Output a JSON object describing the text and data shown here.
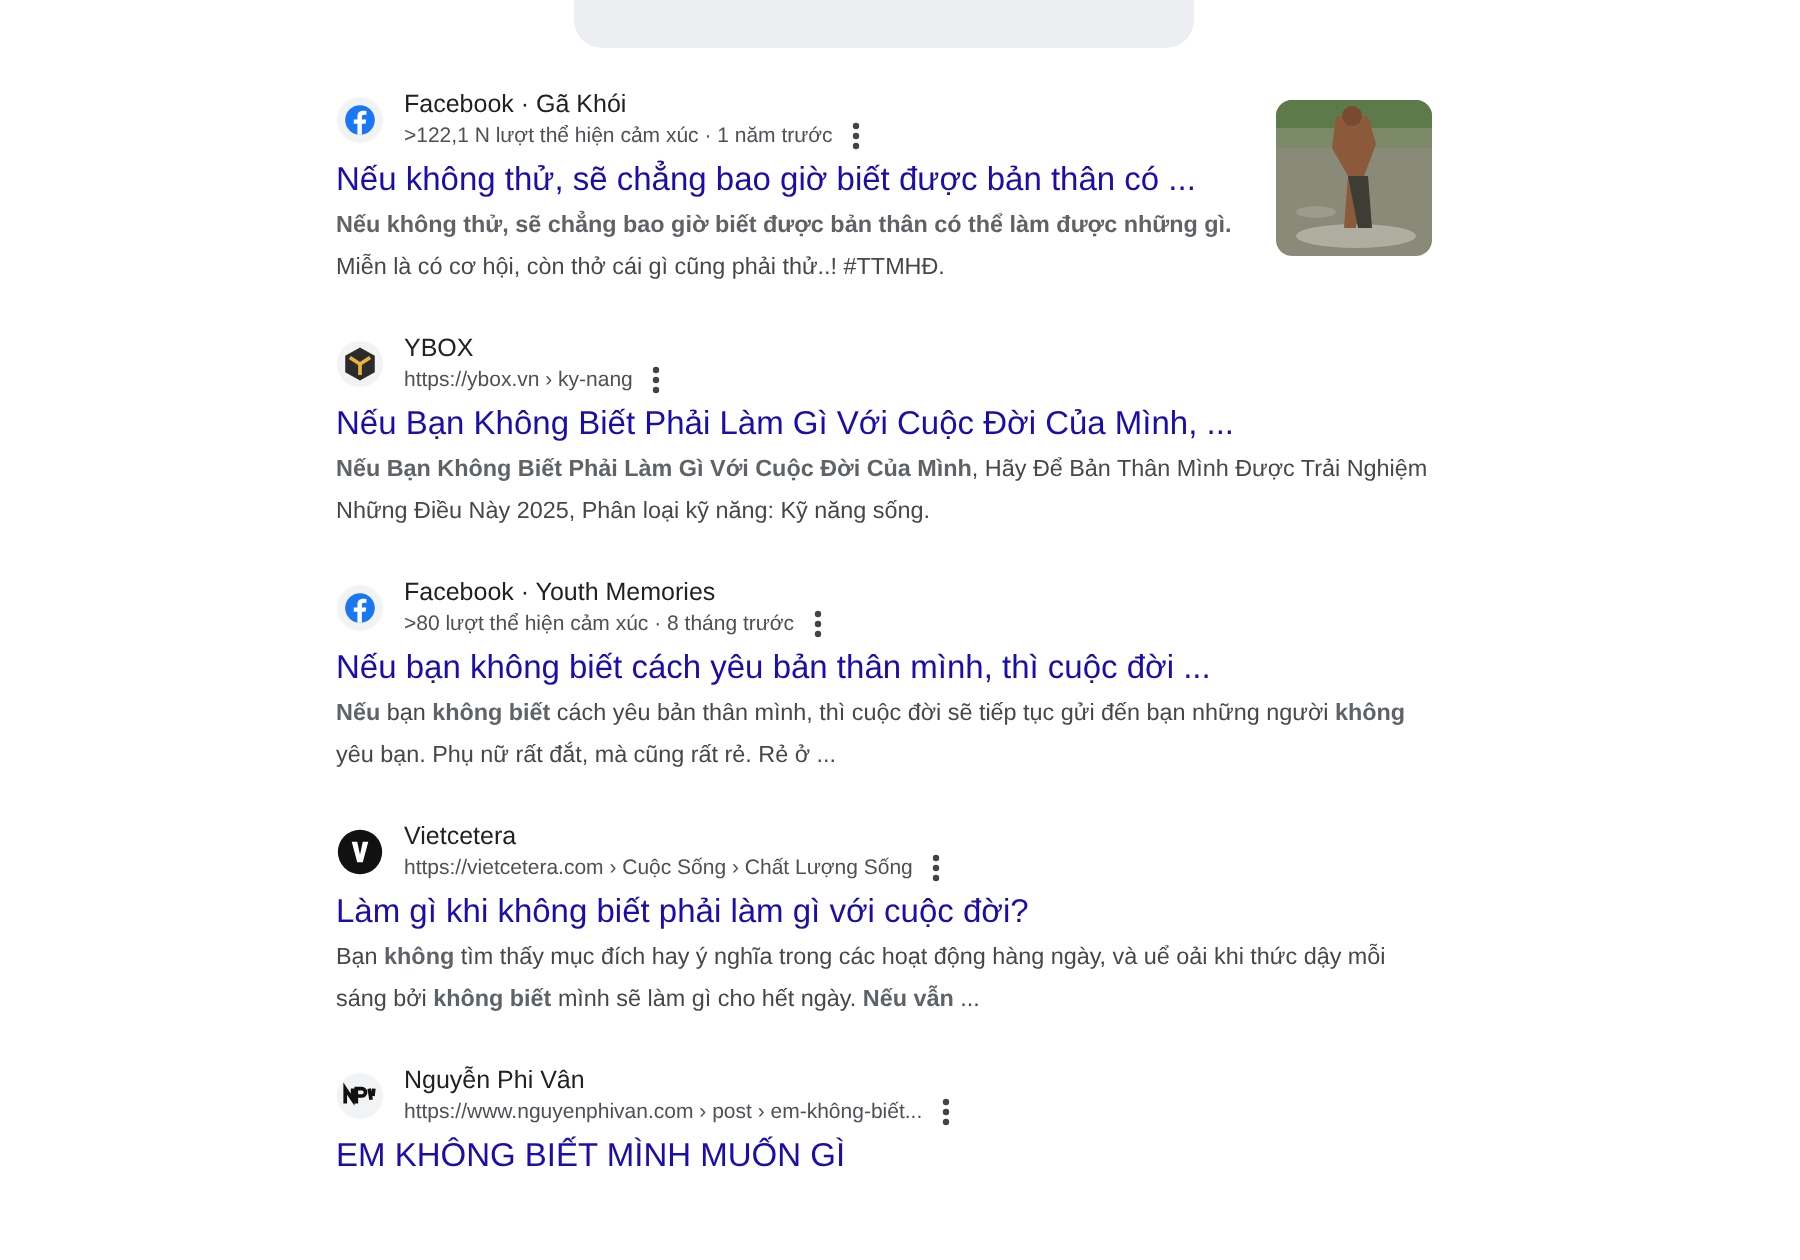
{
  "show_all_button": {
    "visible": true
  },
  "results": [
    {
      "kind": "facebook",
      "source": "Facebook · Gã Khói",
      "meta": ">122,1 N lượt thể hiện cảm xúc · 1 năm trước",
      "title": "Nếu không thử, sẽ chẳng bao giờ biết được bản thân có ...",
      "snippet": "**Nếu không thử, sẽ chẳng bao giờ biết được bản thân có thể làm được những gì.** Miễn là có cơ hội, còn thở cái gì cũng phải thử..! #TTMHĐ."
    },
    {
      "kind": "ybox",
      "source": "YBOX",
      "meta": "https://ybox.vn › ky-nang",
      "title": "Nếu Bạn Không Biết Phải Làm Gì Với Cuộc Đời Của Mình, ...",
      "snippet": "**Nếu Bạn Không Biết Phải Làm Gì Với Cuộc Đời Của Mình**, Hãy Để Bản Thân Mình Được Trải Nghiệm Những Điều Này 2025, Phân loại kỹ năng: Kỹ năng sống."
    },
    {
      "kind": "facebook",
      "source": "Facebook · Youth Memories",
      "meta": ">80 lượt thể hiện cảm xúc · 8 tháng trước",
      "title": "Nếu bạn không biết cách yêu bản thân mình, thì cuộc đời ...",
      "snippet": "**Nếu** bạn **không biết** cách yêu bản thân mình, thì cuộc đời sẽ tiếp tục gửi đến bạn những người **không** yêu bạn. Phụ nữ rất đắt, mà cũng rất rẻ. Rẻ ở ..."
    },
    {
      "kind": "vietcetera",
      "source": "Vietcetera",
      "meta": "https://vietcetera.com › Cuộc Sống › Chất Lượng Sống",
      "title": "Làm gì khi không biết phải làm gì với cuộc đời?",
      "snippet": "Bạn **không** tìm thấy mục đích hay ý nghĩa trong các hoạt động hàng ngày, và uể oải khi thức dậy mỗi sáng bởi **không biết** mình sẽ làm gì cho hết ngày. **Nếu vẫn** ..."
    },
    {
      "kind": "monogram",
      "source": "Nguyễn Phi Vân",
      "meta": "https://www.nguyenphivan.com › post › em-không-biết...",
      "title": "EM KHÔNG BIẾT MÌNH MUỐN GÌ"
    }
  ]
}
